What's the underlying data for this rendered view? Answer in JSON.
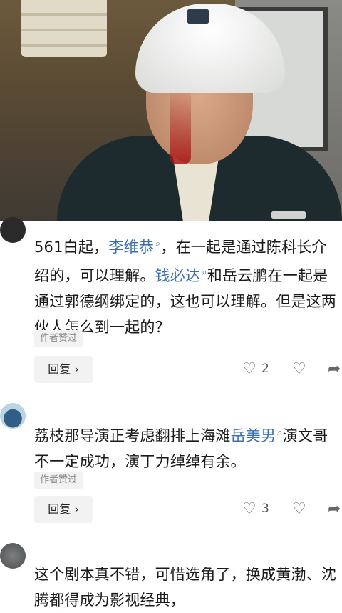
{
  "comments": [
    {
      "segments": {
        "p1": "561白起，",
        "m1": "李维恭",
        "p2": "，在一起是通过陈科长介绍的，可以理解。",
        "m2": "钱必达",
        "p3": "和岳云鹏在一起是通过郭德纲绑定的，这也可以理解。但是这两伙人怎么到一起的？"
      },
      "author_tag": "作者赞过",
      "reply_label": "回复 ›",
      "like_count": "2"
    },
    {
      "segments": {
        "p1": "荔枝那导演正考虑翻排上海滩",
        "m1": "岳美男",
        "p2": "演文哥不一定成功，演丁力绰绰有余。"
      },
      "author_tag": "作者赞过",
      "reply_label": "回复 ›",
      "like_count": "3"
    },
    {
      "segments": {
        "p1": "这个剧本真不错，可惜选角了，换成黄渤、沈腾都得成为影视经典，"
      }
    }
  ],
  "icons": {
    "search_mark": "search-icon",
    "like": "heart-icon",
    "dislike": "broken-heart-icon",
    "share": "share-icon"
  },
  "colors": {
    "mention": "#3b6fb0",
    "tag_bg": "#f2f2f2"
  },
  "glyphs": {
    "search": "⌕",
    "like": "♡",
    "dislike": "♡",
    "share": "➦"
  }
}
